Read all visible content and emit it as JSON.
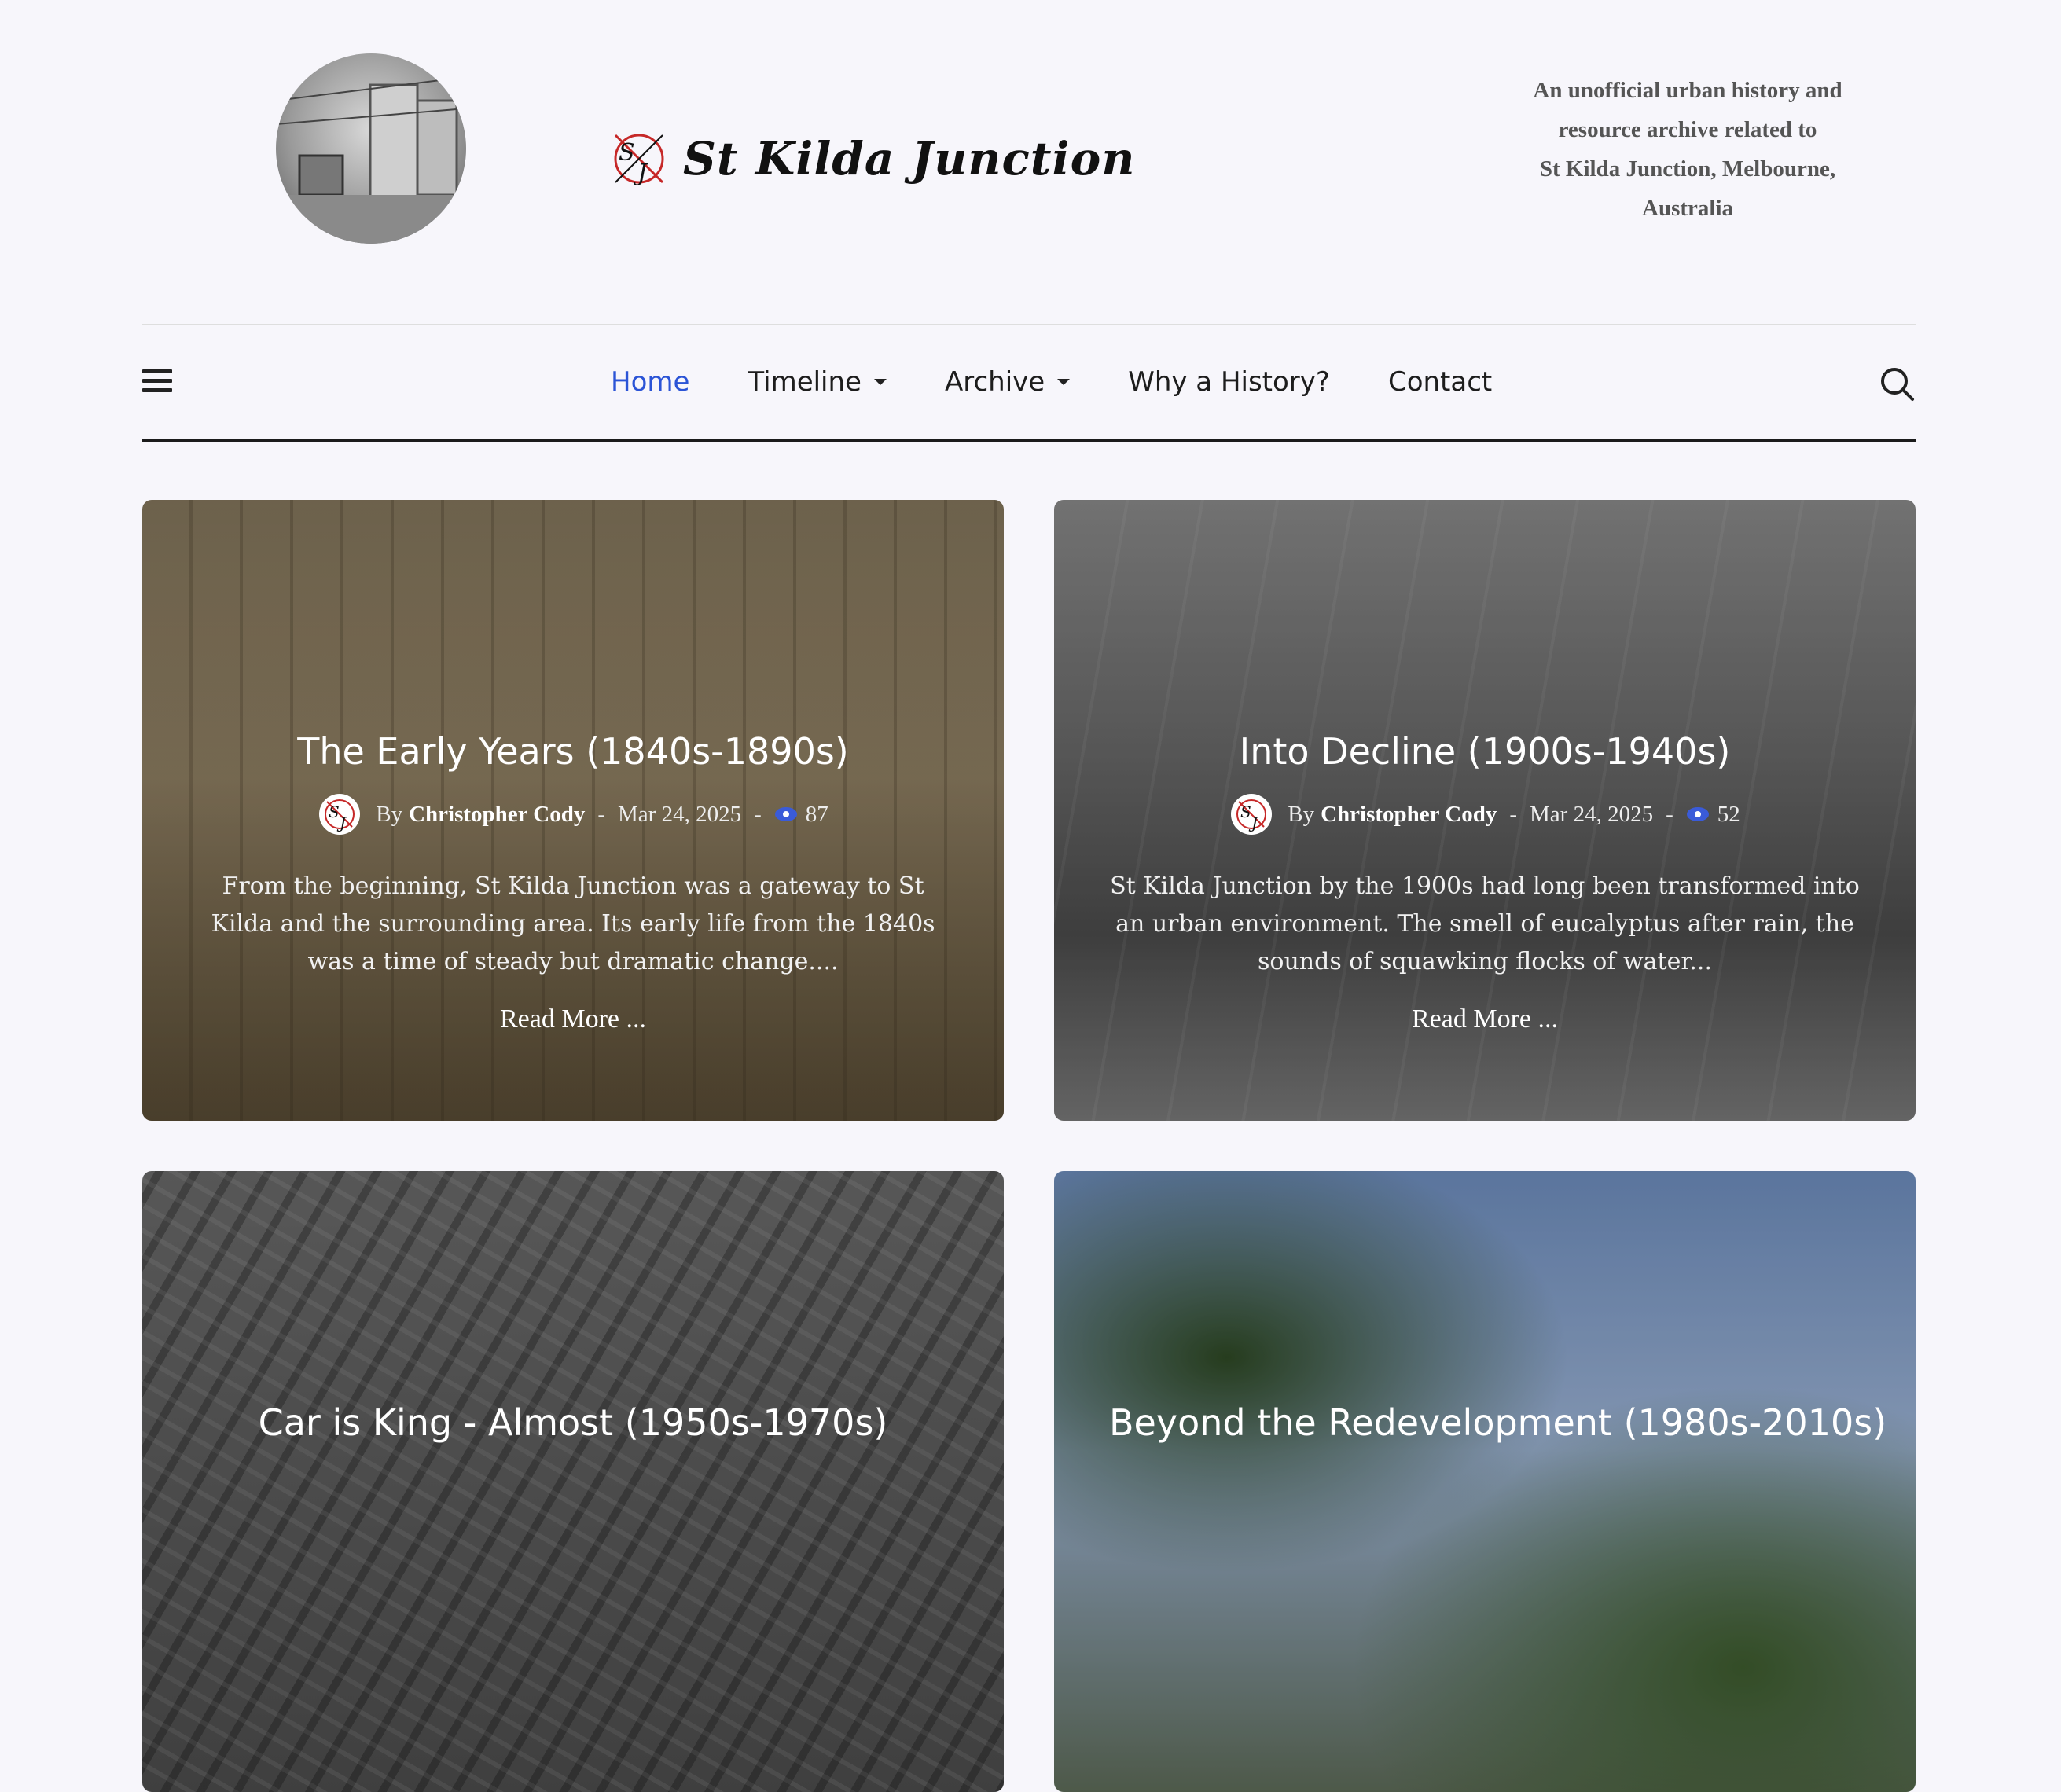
{
  "site": {
    "logo_text": "St Kilda Junction",
    "tagline": [
      "An unofficial urban history and",
      "resource archive related to",
      "St Kilda Junction, Melbourne,",
      "Australia"
    ]
  },
  "nav": {
    "items": [
      {
        "label": "Home",
        "active": true,
        "has_dropdown": false
      },
      {
        "label": "Timeline",
        "active": false,
        "has_dropdown": true
      },
      {
        "label": "Archive",
        "active": false,
        "has_dropdown": true
      },
      {
        "label": "Why a History?",
        "active": false,
        "has_dropdown": false
      },
      {
        "label": "Contact",
        "active": false,
        "has_dropdown": false
      }
    ],
    "menu_icon": "hamburger-icon",
    "search_icon": "search-icon"
  },
  "posts": [
    {
      "title": "The Early Years (1840s-1890s)",
      "by": "By",
      "author": "Christopher Cody",
      "date": "Mar 24, 2025",
      "views": "87",
      "excerpt": "From the beginning, St Kilda Junction was a gateway to St Kilda and the surrounding area. Its early life from the 1840s was a time of steady but dramatic change....",
      "read_more": "Read More ..."
    },
    {
      "title": "Into Decline (1900s-1940s)",
      "by": "By",
      "author": "Christopher Cody",
      "date": "Mar 24, 2025",
      "views": "52",
      "excerpt": "St Kilda Junction by the 1900s had long been transformed into an urban environment. The smell of eucalyptus after rain, the sounds of squawking flocks of water...",
      "read_more": "Read More ..."
    },
    {
      "title": "Car is King - Almost (1950s-1970s)"
    },
    {
      "title": "Beyond the Redevelopment (1980s-2010s)"
    }
  ],
  "colors": {
    "accent": "#2b54d6",
    "background": "#f7f6fb",
    "nav_rule": "#1b1b1b"
  }
}
